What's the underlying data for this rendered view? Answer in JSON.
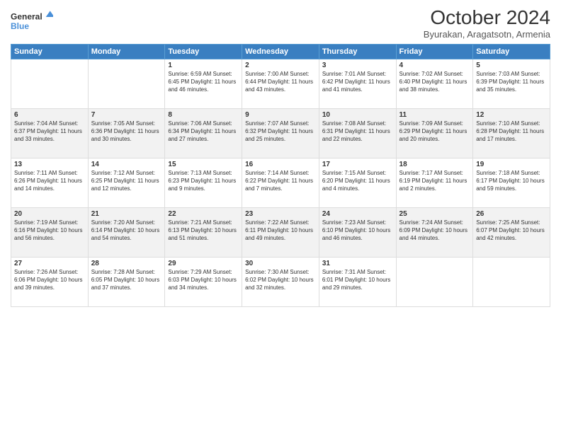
{
  "logo": {
    "line1": "General",
    "line2": "Blue"
  },
  "title": "October 2024",
  "subtitle": "Byurakan, Aragatsotn, Armenia",
  "days_header": [
    "Sunday",
    "Monday",
    "Tuesday",
    "Wednesday",
    "Thursday",
    "Friday",
    "Saturday"
  ],
  "weeks": [
    {
      "cells": [
        {
          "day": "",
          "content": ""
        },
        {
          "day": "",
          "content": ""
        },
        {
          "day": "1",
          "content": "Sunrise: 6:59 AM\nSunset: 6:45 PM\nDaylight: 11 hours and 46 minutes."
        },
        {
          "day": "2",
          "content": "Sunrise: 7:00 AM\nSunset: 6:44 PM\nDaylight: 11 hours and 43 minutes."
        },
        {
          "day": "3",
          "content": "Sunrise: 7:01 AM\nSunset: 6:42 PM\nDaylight: 11 hours and 41 minutes."
        },
        {
          "day": "4",
          "content": "Sunrise: 7:02 AM\nSunset: 6:40 PM\nDaylight: 11 hours and 38 minutes."
        },
        {
          "day": "5",
          "content": "Sunrise: 7:03 AM\nSunset: 6:39 PM\nDaylight: 11 hours and 35 minutes."
        }
      ]
    },
    {
      "cells": [
        {
          "day": "6",
          "content": "Sunrise: 7:04 AM\nSunset: 6:37 PM\nDaylight: 11 hours and 33 minutes."
        },
        {
          "day": "7",
          "content": "Sunrise: 7:05 AM\nSunset: 6:36 PM\nDaylight: 11 hours and 30 minutes."
        },
        {
          "day": "8",
          "content": "Sunrise: 7:06 AM\nSunset: 6:34 PM\nDaylight: 11 hours and 27 minutes."
        },
        {
          "day": "9",
          "content": "Sunrise: 7:07 AM\nSunset: 6:32 PM\nDaylight: 11 hours and 25 minutes."
        },
        {
          "day": "10",
          "content": "Sunrise: 7:08 AM\nSunset: 6:31 PM\nDaylight: 11 hours and 22 minutes."
        },
        {
          "day": "11",
          "content": "Sunrise: 7:09 AM\nSunset: 6:29 PM\nDaylight: 11 hours and 20 minutes."
        },
        {
          "day": "12",
          "content": "Sunrise: 7:10 AM\nSunset: 6:28 PM\nDaylight: 11 hours and 17 minutes."
        }
      ]
    },
    {
      "cells": [
        {
          "day": "13",
          "content": "Sunrise: 7:11 AM\nSunset: 6:26 PM\nDaylight: 11 hours and 14 minutes."
        },
        {
          "day": "14",
          "content": "Sunrise: 7:12 AM\nSunset: 6:25 PM\nDaylight: 11 hours and 12 minutes."
        },
        {
          "day": "15",
          "content": "Sunrise: 7:13 AM\nSunset: 6:23 PM\nDaylight: 11 hours and 9 minutes."
        },
        {
          "day": "16",
          "content": "Sunrise: 7:14 AM\nSunset: 6:22 PM\nDaylight: 11 hours and 7 minutes."
        },
        {
          "day": "17",
          "content": "Sunrise: 7:15 AM\nSunset: 6:20 PM\nDaylight: 11 hours and 4 minutes."
        },
        {
          "day": "18",
          "content": "Sunrise: 7:17 AM\nSunset: 6:19 PM\nDaylight: 11 hours and 2 minutes."
        },
        {
          "day": "19",
          "content": "Sunrise: 7:18 AM\nSunset: 6:17 PM\nDaylight: 10 hours and 59 minutes."
        }
      ]
    },
    {
      "cells": [
        {
          "day": "20",
          "content": "Sunrise: 7:19 AM\nSunset: 6:16 PM\nDaylight: 10 hours and 56 minutes."
        },
        {
          "day": "21",
          "content": "Sunrise: 7:20 AM\nSunset: 6:14 PM\nDaylight: 10 hours and 54 minutes."
        },
        {
          "day": "22",
          "content": "Sunrise: 7:21 AM\nSunset: 6:13 PM\nDaylight: 10 hours and 51 minutes."
        },
        {
          "day": "23",
          "content": "Sunrise: 7:22 AM\nSunset: 6:11 PM\nDaylight: 10 hours and 49 minutes."
        },
        {
          "day": "24",
          "content": "Sunrise: 7:23 AM\nSunset: 6:10 PM\nDaylight: 10 hours and 46 minutes."
        },
        {
          "day": "25",
          "content": "Sunrise: 7:24 AM\nSunset: 6:09 PM\nDaylight: 10 hours and 44 minutes."
        },
        {
          "day": "26",
          "content": "Sunrise: 7:25 AM\nSunset: 6:07 PM\nDaylight: 10 hours and 42 minutes."
        }
      ]
    },
    {
      "cells": [
        {
          "day": "27",
          "content": "Sunrise: 7:26 AM\nSunset: 6:06 PM\nDaylight: 10 hours and 39 minutes."
        },
        {
          "day": "28",
          "content": "Sunrise: 7:28 AM\nSunset: 6:05 PM\nDaylight: 10 hours and 37 minutes."
        },
        {
          "day": "29",
          "content": "Sunrise: 7:29 AM\nSunset: 6:03 PM\nDaylight: 10 hours and 34 minutes."
        },
        {
          "day": "30",
          "content": "Sunrise: 7:30 AM\nSunset: 6:02 PM\nDaylight: 10 hours and 32 minutes."
        },
        {
          "day": "31",
          "content": "Sunrise: 7:31 AM\nSunset: 6:01 PM\nDaylight: 10 hours and 29 minutes."
        },
        {
          "day": "",
          "content": ""
        },
        {
          "day": "",
          "content": ""
        }
      ]
    }
  ]
}
